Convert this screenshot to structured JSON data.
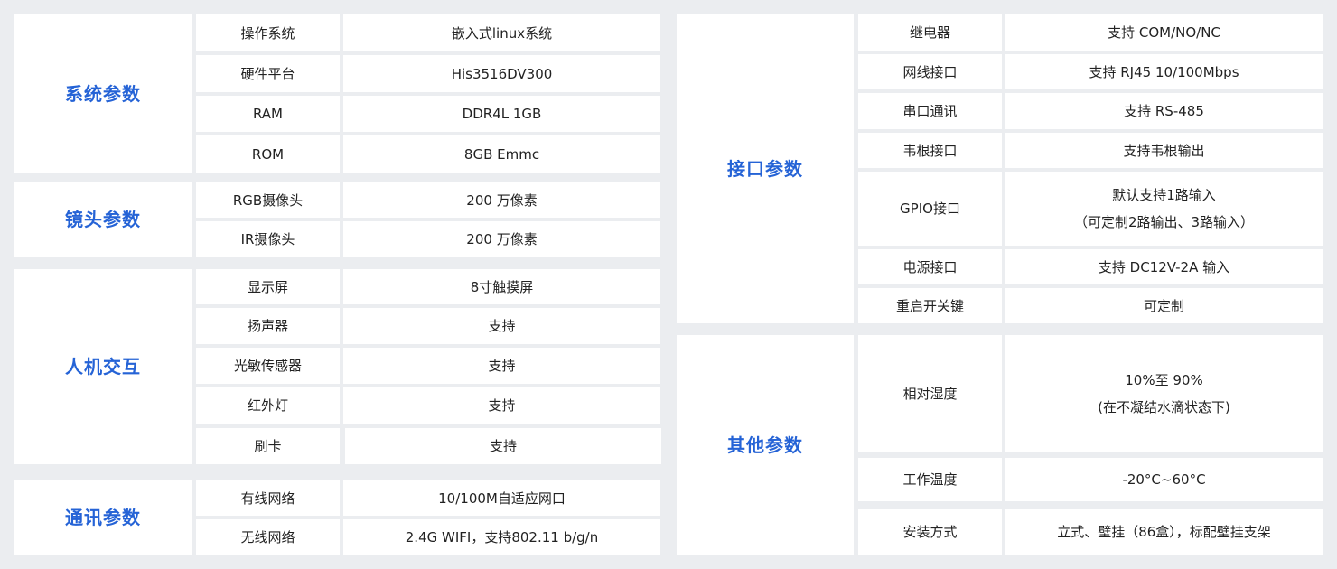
{
  "left": {
    "system": {
      "category": "系统参数",
      "rows": [
        {
          "label": "操作系统",
          "value": "嵌入式linux系统"
        },
        {
          "label": "硬件平台",
          "value": "His3516DV300"
        },
        {
          "label": "RAM",
          "value": "DDR4L 1GB"
        },
        {
          "label": "ROM",
          "value": "8GB Emmc"
        }
      ]
    },
    "lens": {
      "category": "镜头参数",
      "rows": [
        {
          "label": "RGB摄像头",
          "value": "200 万像素"
        },
        {
          "label": "IR摄像头",
          "value": "200 万像素"
        }
      ]
    },
    "hmi": {
      "category": "人机交互",
      "rows": [
        {
          "label": "显示屏",
          "value": "8寸触摸屏"
        },
        {
          "label": "扬声器",
          "value": "支持"
        },
        {
          "label": "光敏传感器",
          "value": "支持"
        },
        {
          "label": "红外灯",
          "value": "支持"
        },
        {
          "label": "刷卡",
          "value": "支持"
        }
      ]
    },
    "comm": {
      "category": "通讯参数",
      "rows": [
        {
          "label": "有线网络",
          "value": "10/100M自适应网口"
        },
        {
          "label": "无线网络",
          "value": "2.4G  WIFI，支持802.11 b/g/n"
        }
      ]
    }
  },
  "right": {
    "interface": {
      "category": "接口参数",
      "rows": [
        {
          "label": "继电器",
          "value": "支持 COM/NO/NC"
        },
        {
          "label": "网线接口",
          "value": "支持 RJ45 10/100Mbps"
        },
        {
          "label": "串口通讯",
          "value": "支持 RS-485"
        },
        {
          "label": "韦根接口",
          "value": "支持韦根输出"
        },
        {
          "label": "GPIO接口",
          "value_line1": "默认支持1路输入",
          "value_line2": "（可定制2路输出、3路输入）"
        },
        {
          "label": "电源接口",
          "value": "支持 DC12V-2A 输入"
        },
        {
          "label": "重启开关键",
          "value": "可定制"
        }
      ]
    },
    "other": {
      "category": "其他参数",
      "rows": [
        {
          "label": "相对湿度",
          "value_line1": "10%至 90%",
          "value_line2": "(在不凝结水滴状态下)"
        },
        {
          "label": "工作温度",
          "value": "-20°C~60°C"
        },
        {
          "label": "安装方式",
          "value": "立式、壁挂（86盒），标配壁挂支架"
        }
      ]
    }
  }
}
